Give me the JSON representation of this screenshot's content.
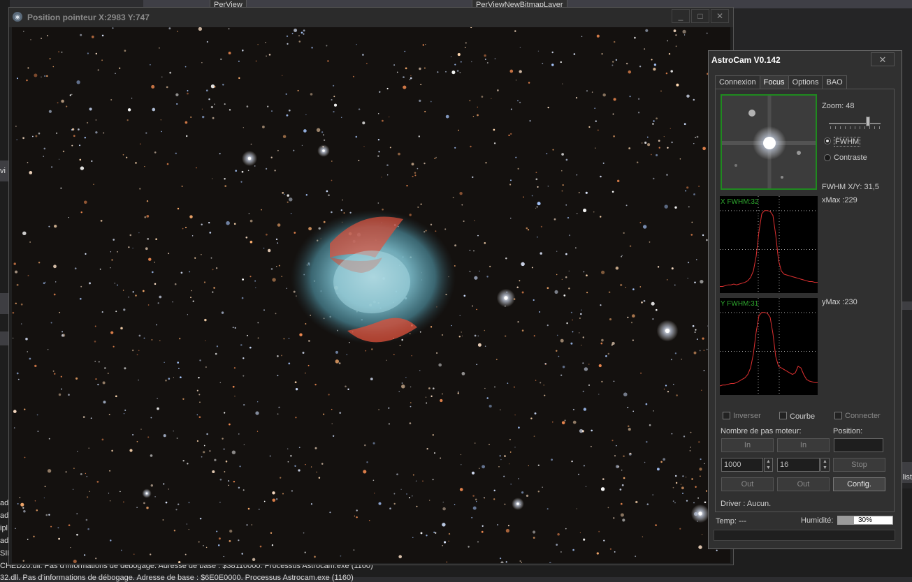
{
  "background": {
    "top_tabs": [
      "PerView",
      "PerViewNewBitmapLayer"
    ],
    "output_lines": [
      "CHED20.dll. Pas d'informations de débogage. Adresse de base : $38110000. Processus Astrocam.exe (1160)",
      "32.dll. Pas d'informations de débogage. Adresse de base : $6E0E0000. Processus Astrocam.exe (1160)"
    ],
    "left_stubs": [
      "vi",
      "ad",
      "ad",
      "ipl",
      "ad",
      "SIN"
    ],
    "right_stub": "list"
  },
  "image_window": {
    "title": "Position pointeur X:2983 Y:747",
    "minimize": "_",
    "maximize": "□",
    "close": "✕"
  },
  "astrocam": {
    "title": "AstroCam V0.142",
    "close": "✕",
    "tabs": [
      "Connexion",
      "Focus",
      "Options",
      "BAO"
    ],
    "active_tab": "Focus",
    "zoom_label": "Zoom: 48",
    "zoom_level": 0.75,
    "radio_fwhm": "FWHM",
    "radio_contraste": "Contraste",
    "fwhm_xy": "FWHM X/Y:  31,5",
    "xmax": "xMax :229",
    "ymax": "yMax :230",
    "x_graph_label": "X FWHM:32",
    "y_graph_label": "Y FWHM:31",
    "x_profile": [
      3,
      3,
      4,
      5,
      5,
      6,
      5,
      6,
      7,
      8,
      10,
      14,
      22,
      40,
      70,
      92,
      96,
      96,
      95,
      90,
      66,
      35,
      22,
      18,
      17,
      16,
      15,
      14,
      13,
      12,
      11,
      10,
      9,
      9,
      8,
      8
    ],
    "y_profile": [
      6,
      7,
      7,
      8,
      9,
      9,
      10,
      12,
      14,
      16,
      20,
      28,
      45,
      72,
      92,
      96,
      96,
      95,
      90,
      70,
      42,
      30,
      28,
      26,
      24,
      22,
      20,
      22,
      30,
      28,
      20,
      14,
      12,
      11,
      10,
      10
    ],
    "check_inverser": "Inverser",
    "check_courbe": "Courbe",
    "check_connecter": "Connecter",
    "steps_label": "Nombre de pas moteur:",
    "position_label": "Position:",
    "btn_in": "In",
    "btn_out": "Out",
    "btn_stop": "Stop",
    "btn_config": "Config.",
    "steps_value_1": "1000",
    "steps_value_2": "16",
    "driver": "Driver : Aucun.",
    "temp": "Temp: ---",
    "humidity_label": "Humidité:",
    "humidity_value": "30%",
    "humidity_fraction": 0.3
  },
  "colors": {
    "green_frame": "#1f8a1f",
    "graph_line": "#e03030",
    "graph_label": "#2ea82e",
    "nebula_teal": "#6fb6c4",
    "nebula_red": "#e0503a"
  }
}
